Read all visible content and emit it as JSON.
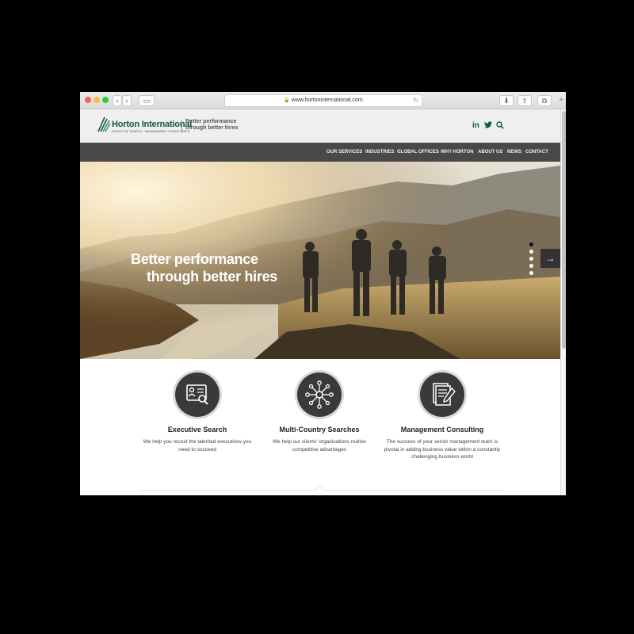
{
  "browser": {
    "url": "www.hortoninternational.com",
    "back_glyph": "‹",
    "forward_glyph": "›",
    "sidebar_glyph": "▭",
    "reload_glyph": "↻",
    "download_glyph": "⬇",
    "share_glyph": "⇧",
    "tabs_glyph": "⧉",
    "new_tab_glyph": "+"
  },
  "header": {
    "logo_name": "Horton International",
    "logo_subtitle": "EXECUTIVE SEARCH · MANAGEMENT CONSULTANTS",
    "tagline_line1": "Better performance",
    "tagline_line2": "through better hires",
    "linkedin": "in",
    "twitter_glyph": "🐦",
    "search_glyph": "⚲"
  },
  "nav": {
    "items": [
      "OUR SERVICES",
      "INDUSTRIES",
      "GLOBAL OFFICES",
      "WHY HORTON",
      "ABOUT US",
      "NEWS",
      "CONTACT"
    ]
  },
  "hero": {
    "title_line1": "Better performance",
    "title_line2": "through better hires",
    "next_glyph": "→",
    "slide_count": 5,
    "active_slide": 1
  },
  "services": [
    {
      "title": "Executive Search",
      "description": "We help you recruit the talented executives you need to succeed",
      "icon": "candidate-profile-icon"
    },
    {
      "title": "Multi-Country Searches",
      "description": "We help our clients' organisations realise competitive advantages",
      "icon": "network-hub-icon"
    },
    {
      "title": "Management Consulting",
      "description": "The success of your senior management team is pivotal in adding business value within a constantly challenging business world",
      "icon": "document-pen-icon"
    }
  ],
  "colors": {
    "brand_green": "#0f5b37",
    "nav_bg": "#4a4949",
    "header_bg": "#efefef"
  }
}
